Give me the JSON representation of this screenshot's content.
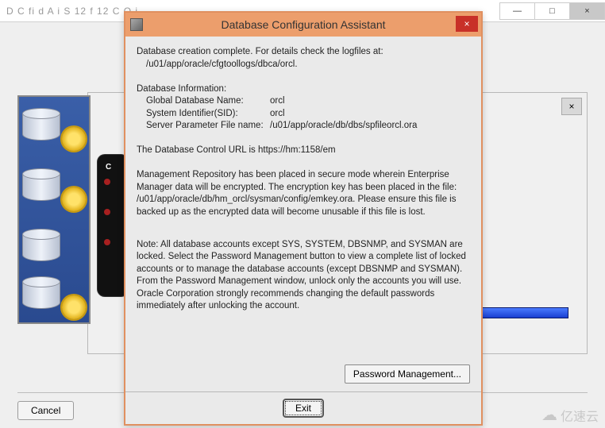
{
  "parent": {
    "title_fragment": "D              C   fi           d      A   i           S      12   f 12   C            O    i",
    "minimize": "—",
    "maximize": "□",
    "close": "×"
  },
  "wizard": {
    "close": "×",
    "cancel": "Cancel",
    "dark_c": "C"
  },
  "dialog": {
    "title": "Database Configuration Assistant",
    "close": "×",
    "line1": "Database creation complete. For details check the logfiles at:",
    "line2": "/u01/app/oracle/cfgtoollogs/dbca/orcl.",
    "info_header": "Database Information:",
    "info": {
      "gdn_label": "Global Database Name:",
      "gdn_value": "orcl",
      "sid_label": "System Identifier(SID):",
      "sid_value": "orcl",
      "spf_label": "Server Parameter File name:",
      "spf_value": "/u01/app/oracle/db/dbs/spfileorcl.ora"
    },
    "control_url": "The Database Control URL is https://hm:1158/em",
    "mgmt_text": "Management Repository has been placed in secure mode wherein Enterprise Manager data will be encrypted.  The encryption key has been placed in the file: /u01/app/oracle/db/hm_orcl/sysman/config/emkey.ora.   Please ensure this file is backed up as the encrypted data will become unusable if this file is lost.",
    "note_text": "Note: All database accounts except SYS, SYSTEM, DBSNMP, and SYSMAN are locked. Select the Password Management button to view a complete list of locked accounts or to manage the database accounts (except DBSNMP and SYSMAN). From the Password Management window, unlock only the accounts you will use. Oracle Corporation strongly recommends changing the default passwords immediately after unlocking the account.",
    "pm_button": "Password Management...",
    "exit": "Exit"
  },
  "watermark": {
    "text": "亿速云"
  }
}
